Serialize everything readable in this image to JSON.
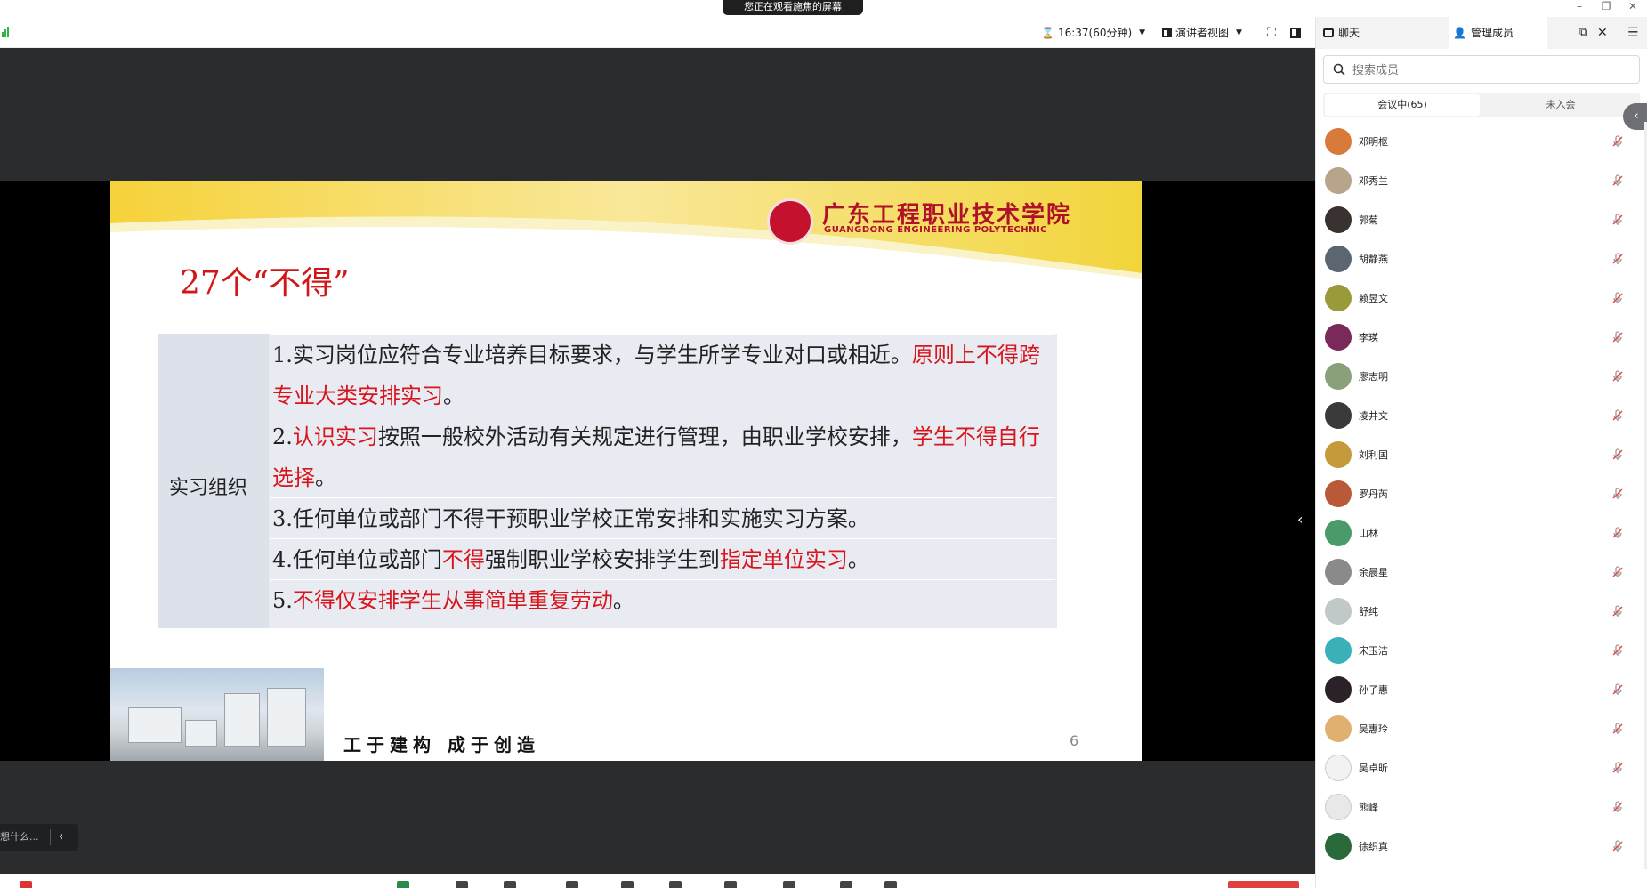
{
  "titlebar": {
    "share_banner": "您正在观看施焦的屏幕"
  },
  "toolbar": {
    "time": "16:37(60分钟)",
    "view": "演讲者视图"
  },
  "panel": {
    "tab_chat": "聊天",
    "tab_members": "管理成员",
    "search_placeholder": "搜索成员",
    "in_meeting": "会议中(65)",
    "not_joined": "未入会",
    "members": [
      {
        "name": "邓明枢",
        "color": "#d87a3a"
      },
      {
        "name": "邓秀兰",
        "color": "#b7a48a"
      },
      {
        "name": "郭菊",
        "color": "#3a3230"
      },
      {
        "name": "胡静燕",
        "color": "#5b6670"
      },
      {
        "name": "赖昱文",
        "color": "#9a9a3a"
      },
      {
        "name": "李瑛",
        "color": "#7a2a5a"
      },
      {
        "name": "廖志明",
        "color": "#8aa07a"
      },
      {
        "name": "凌井文",
        "color": "#3a3a3a"
      },
      {
        "name": "刘利国",
        "color": "#c49a3a"
      },
      {
        "name": "罗丹芮",
        "color": "#b85a3a"
      },
      {
        "name": "山林",
        "color": "#4a9a6a"
      },
      {
        "name": "余晨星",
        "color": "#8a8a8a"
      },
      {
        "name": "舒纯",
        "color": "#c0c8c8"
      },
      {
        "name": "宋玉洁",
        "color": "#3ab0b8"
      },
      {
        "name": "孙子惠",
        "color": "#2a2228"
      },
      {
        "name": "吴惠玲",
        "color": "#e0b070"
      },
      {
        "name": "吴卓昕",
        "color": "#f2f2f2"
      },
      {
        "name": "熊峰",
        "color": "#e8e8e8"
      },
      {
        "name": "徐织真",
        "color": "#2a6a3a"
      }
    ]
  },
  "slide": {
    "title": "27个“不得”",
    "school_name": "广东工程职业技术学院",
    "school_en": "GUANGDONG ENGINEERING POLYTECHNIC",
    "table_label": "实习组织",
    "rows": [
      {
        "a": "1.实习岗位应符合专业培养目标要求，与学生所学专业对口或相近。",
        "b": "原则上不得跨专业大类安排实习",
        "c": "。"
      },
      {
        "pre": "2.",
        "r1": "认识实习",
        "mid": "按照一般校外活动有关规定进行管理，由职业学校安排，",
        "r2": "学生不得自行选择",
        "end": "。"
      },
      {
        "a": "3.任何单位或部门不得干预职业学校正常安排和实施实习方案。"
      },
      {
        "pre": "4.任何单位或部门",
        "r1": "不得",
        "mid": "强制职业学校安排学生到",
        "r2": "指定单位实习",
        "end": "。"
      },
      {
        "pre": "5.",
        "r1": "不得仅安排学生从事简单重复劳动",
        "end": "。"
      }
    ],
    "motto": "工于建构 成于创造",
    "page_number": "6"
  },
  "bottom": {
    "chat_hint": "想什么..."
  }
}
